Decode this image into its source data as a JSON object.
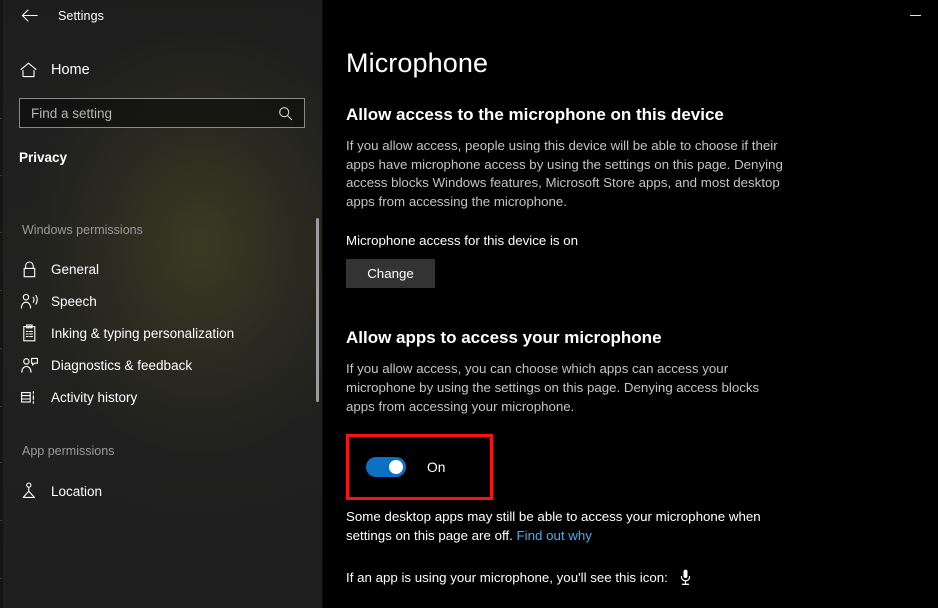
{
  "window": {
    "app_title": "Settings",
    "back_icon": "back-arrow-icon",
    "minimize_label": "Minimize"
  },
  "sidebar": {
    "home": {
      "label": "Home",
      "icon": "home-icon"
    },
    "search": {
      "placeholder": "Find a setting",
      "value": "",
      "icon": "search-icon"
    },
    "page_label": "Privacy",
    "groups": [
      {
        "heading": "Windows permissions",
        "items": [
          {
            "label": "General",
            "icon": "lock-icon"
          },
          {
            "label": "Speech",
            "icon": "speech-person-icon"
          },
          {
            "label": "Inking & typing personalization",
            "icon": "clipboard-icon"
          },
          {
            "label": "Diagnostics & feedback",
            "icon": "person-feedback-icon"
          },
          {
            "label": "Activity history",
            "icon": "activity-history-icon"
          }
        ]
      },
      {
        "heading": "App permissions",
        "items": [
          {
            "label": "Location",
            "icon": "location-pin-icon"
          }
        ]
      }
    ]
  },
  "main": {
    "page_title": "Microphone",
    "sections": [
      {
        "heading": "Allow access to the microphone on this device",
        "description": "If you allow access, people using this device will be able to choose if their apps have microphone access by using the settings on this page. Denying access blocks Windows features, Microsoft Store apps, and most desktop apps from accessing the microphone.",
        "status": "Microphone access for this device is on",
        "button_label": "Change"
      },
      {
        "heading": "Allow apps to access your microphone",
        "description": "If you allow access, you can choose which apps can access your microphone by using the settings on this page. Denying access blocks apps from accessing your microphone.",
        "toggle": {
          "state_label": "On",
          "checked": true
        },
        "note_text": "Some desktop apps may still be able to access your microphone when settings on this page are off. ",
        "note_link": "Find out why",
        "icon_note": "If an app is using your microphone, you'll see this icon:",
        "icon_note_glyph": "microphone-icon"
      }
    ]
  },
  "colors": {
    "accent_blue": "#0c71c3",
    "highlight_red": "#fc1212",
    "link_blue": "#4cabe8",
    "button_gray": "#333333"
  }
}
